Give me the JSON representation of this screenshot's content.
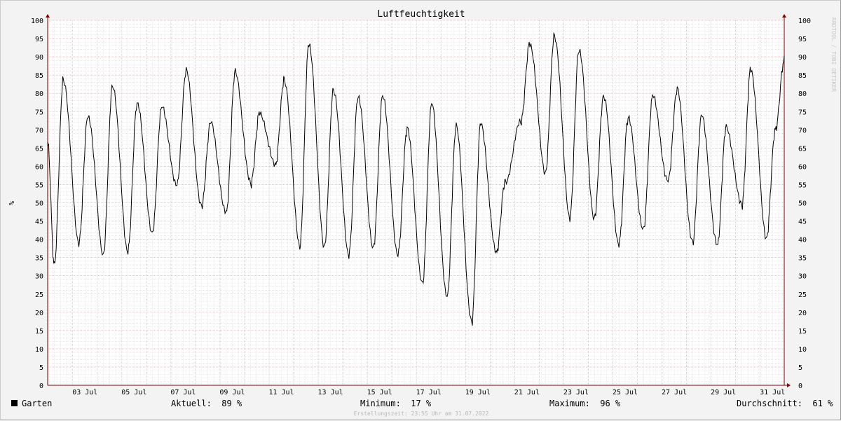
{
  "chart_data": {
    "type": "line",
    "title": "Luftfeuchtigkeit",
    "ylabel": "%",
    "ylim": [
      0,
      100
    ],
    "y_ticks": [
      "0",
      "5",
      "10",
      "15",
      "20",
      "25",
      "30",
      "35",
      "40",
      "45",
      "50",
      "55",
      "60",
      "65",
      "70",
      "75",
      "80",
      "85",
      "90",
      "95",
      "100"
    ],
    "x_ticks": [
      {
        "day": 3,
        "label": "03 Jul"
      },
      {
        "day": 5,
        "label": "05 Jul"
      },
      {
        "day": 7,
        "label": "07 Jul"
      },
      {
        "day": 9,
        "label": "09 Jul"
      },
      {
        "day": 11,
        "label": "11 Jul"
      },
      {
        "day": 13,
        "label": "13 Jul"
      },
      {
        "day": 15,
        "label": "15 Jul"
      },
      {
        "day": 17,
        "label": "17 Jul"
      },
      {
        "day": 19,
        "label": "19 Jul"
      },
      {
        "day": 21,
        "label": "21 Jul"
      },
      {
        "day": 23,
        "label": "23 Jul"
      },
      {
        "day": 25,
        "label": "25 Jul"
      },
      {
        "day": 27,
        "label": "27 Jul"
      },
      {
        "day": 29,
        "label": "29 Jul"
      },
      {
        "day": 31,
        "label": "31 Jul"
      }
    ],
    "xlim_days": [
      1.98,
      31.98
    ],
    "grid": true,
    "series": [
      {
        "name": "Garten",
        "color": "#000000",
        "daily": [
          {
            "day": 2,
            "min": 33,
            "max": 84
          },
          {
            "day": 3,
            "min": 39,
            "max": 74
          },
          {
            "day": 4,
            "min": 36,
            "max": 82
          },
          {
            "day": 5,
            "min": 37,
            "max": 77
          },
          {
            "day": 6,
            "min": 42,
            "max": 76
          },
          {
            "day": 7,
            "min": 55,
            "max": 86
          },
          {
            "day": 8,
            "min": 49,
            "max": 72
          },
          {
            "day": 9,
            "min": 47,
            "max": 86
          },
          {
            "day": 10,
            "min": 55,
            "max": 75
          },
          {
            "day": 11,
            "min": 60,
            "max": 84
          },
          {
            "day": 12,
            "min": 38,
            "max": 94
          },
          {
            "day": 13,
            "min": 38,
            "max": 81
          },
          {
            "day": 14,
            "min": 36,
            "max": 79
          },
          {
            "day": 15,
            "min": 38,
            "max": 79
          },
          {
            "day": 16,
            "min": 36,
            "max": 70
          },
          {
            "day": 17,
            "min": 28,
            "max": 77
          },
          {
            "day": 18,
            "min": 24,
            "max": 71
          },
          {
            "day": 19,
            "min": 17,
            "max": 72
          },
          {
            "day": 20,
            "min": 36,
            "max": 56
          },
          {
            "day": 21,
            "min": 72,
            "max": 94
          },
          {
            "day": 22,
            "min": 58,
            "max": 96
          },
          {
            "day": 23,
            "min": 46,
            "max": 92
          },
          {
            "day": 24,
            "min": 46,
            "max": 79
          },
          {
            "day": 25,
            "min": 39,
            "max": 73
          },
          {
            "day": 26,
            "min": 43,
            "max": 79
          },
          {
            "day": 27,
            "min": 56,
            "max": 81
          },
          {
            "day": 28,
            "min": 39,
            "max": 74
          },
          {
            "day": 29,
            "min": 38,
            "max": 71
          },
          {
            "day": 30,
            "min": 49,
            "max": 87
          },
          {
            "day": 31,
            "min": 40,
            "max": 70
          }
        ]
      }
    ]
  },
  "legend": {
    "series_label": "Garten",
    "current": "Aktuell:  89 %",
    "minimum": "Minimum:  17 %",
    "maximum": "Maximum:  96 %",
    "average": "Durchschnitt:  61 %"
  },
  "footer": "Erstellungszeit: 23:55 Uhr am 31.07.2022",
  "watermark": "RRDTOOL / TOBI OETIKER",
  "colors": {
    "minor_grid": "#d9d9d9",
    "major_grid": "#e8a9a9",
    "axis": "#7f0000"
  }
}
